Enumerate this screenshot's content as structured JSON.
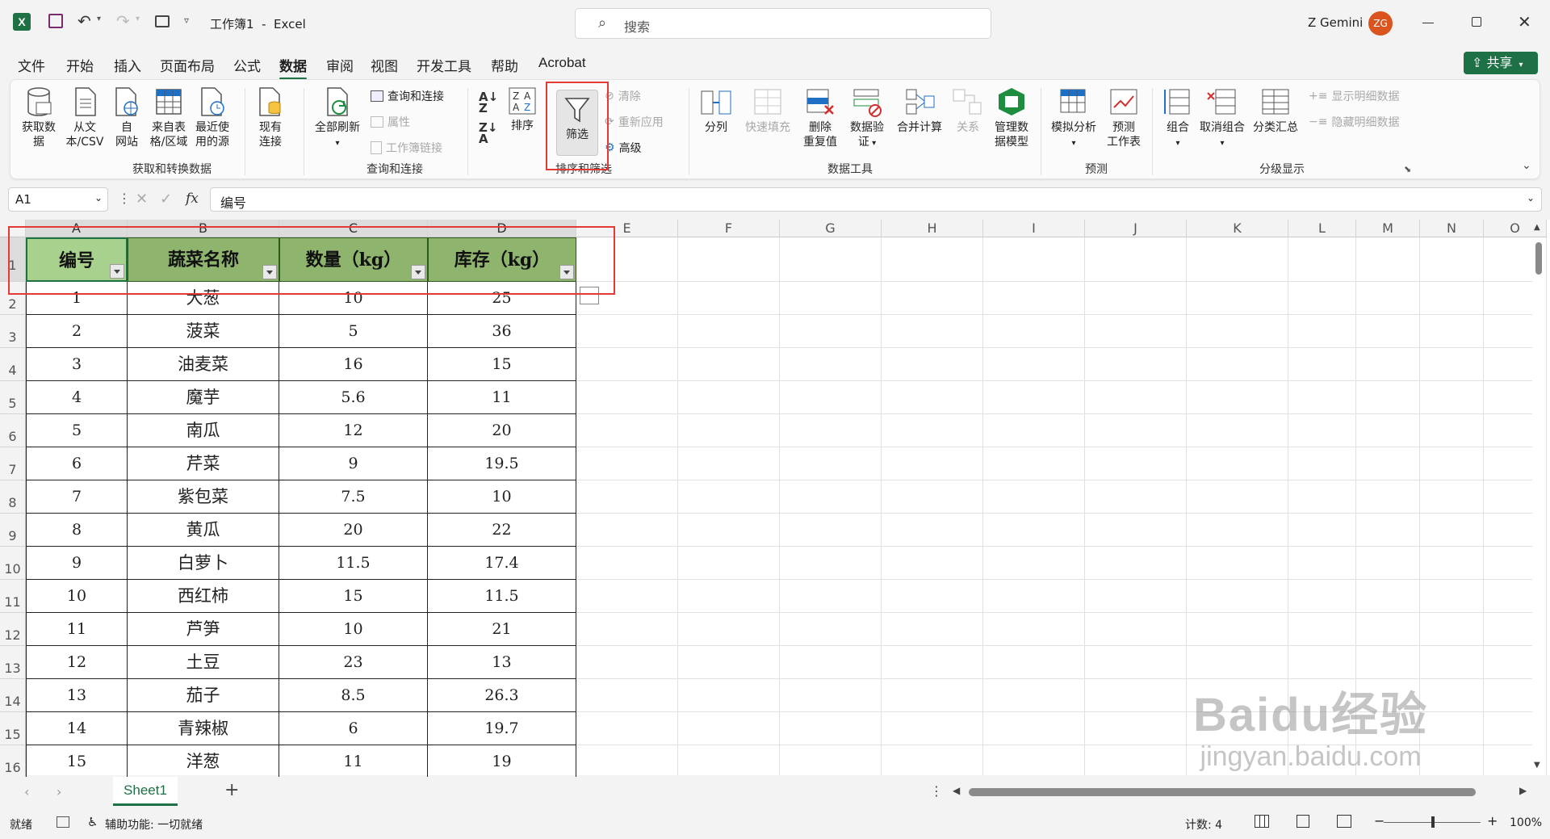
{
  "titlebar": {
    "doc_title": "工作簿1  -  Excel",
    "search_placeholder": "搜索",
    "user_name": "Z Gemini",
    "avatar_initials": "ZG"
  },
  "tabs": [
    "文件",
    "开始",
    "插入",
    "页面布局",
    "公式",
    "数据",
    "审阅",
    "视图",
    "开发工具",
    "帮助",
    "Acrobat"
  ],
  "active_tab": "数据",
  "share_label": "共享",
  "ribbon": {
    "get_data": "获取数\n据",
    "from_csv": "从文\n本/CSV",
    "from_web": "自\n网站",
    "from_table": "来自表\n格/区域",
    "recent_sources": "最近使\n用的源",
    "existing_conn": "现有\n连接",
    "group1": "获取和转换数据",
    "refresh_all": "全部刷新",
    "queries_conn": "查询和连接",
    "properties": "属性",
    "workbook_links": "工作簿链接",
    "group2": "查询和连接",
    "sort": "排序",
    "filter": "筛选",
    "clear": "清除",
    "reapply": "重新应用",
    "advanced": "高级",
    "group3": "排序和筛选",
    "text_to_col": "分列",
    "flash_fill": "快速填充",
    "remove_dup": "删除\n重复值",
    "data_valid": "数据验\n证",
    "consolidate": "合并计算",
    "relations": "关系",
    "data_model": "管理数\n据模型",
    "group4": "数据工具",
    "whatif": "模拟分析",
    "forecast": "预测\n工作表",
    "group5": "预测",
    "group_btn": "组合",
    "ungroup": "取消组合",
    "subtotal": "分类汇总",
    "show_detail": "显示明细数据",
    "hide_detail": "隐藏明细数据",
    "group6": "分级显示"
  },
  "formula": {
    "name_box": "A1",
    "fx": "fx",
    "content": "编号"
  },
  "columns": [
    "A",
    "B",
    "C",
    "D",
    "E",
    "F",
    "G",
    "H",
    "I",
    "J",
    "K",
    "L",
    "M",
    "N",
    "O"
  ],
  "rows": [
    "1",
    "2",
    "3",
    "4",
    "5",
    "6",
    "7",
    "8",
    "9",
    "10",
    "11",
    "12",
    "13",
    "14",
    "15",
    "16"
  ],
  "table": {
    "headers": [
      "编号",
      "蔬菜名称",
      "数量（kg）",
      "库存（kg）"
    ],
    "data": [
      [
        "1",
        "大葱",
        "10",
        "25"
      ],
      [
        "2",
        "菠菜",
        "5",
        "36"
      ],
      [
        "3",
        "油麦菜",
        "16",
        "15"
      ],
      [
        "4",
        "魔芋",
        "5.6",
        "11"
      ],
      [
        "5",
        "南瓜",
        "12",
        "20"
      ],
      [
        "6",
        "芹菜",
        "9",
        "19.5"
      ],
      [
        "7",
        "紫包菜",
        "7.5",
        "10"
      ],
      [
        "8",
        "黄瓜",
        "20",
        "22"
      ],
      [
        "9",
        "白萝卜",
        "11.5",
        "17.4"
      ],
      [
        "10",
        "西红柿",
        "15",
        "11.5"
      ],
      [
        "11",
        "芦笋",
        "10",
        "21"
      ],
      [
        "12",
        "土豆",
        "23",
        "13"
      ],
      [
        "13",
        "茄子",
        "8.5",
        "26.3"
      ],
      [
        "14",
        "青辣椒",
        "6",
        "19.7"
      ],
      [
        "15",
        "洋葱",
        "11",
        "19"
      ]
    ]
  },
  "sheet_tab": "Sheet1",
  "status": {
    "ready": "就绪",
    "accessibility": "辅助功能: 一切就绪",
    "count": "计数: 4",
    "zoom": "100%"
  },
  "watermark": {
    "line1": "Baidu经验",
    "line2": "jingyan.baidu.com"
  },
  "colors": {
    "header_green": "#8eb46e",
    "accent": "#1e7145",
    "highlight": "#e53935"
  }
}
